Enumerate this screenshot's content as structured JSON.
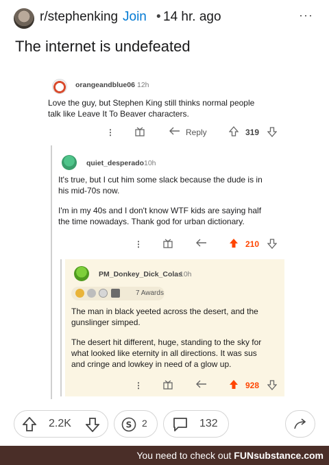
{
  "post": {
    "subreddit": "r/stephenking",
    "join_label": "Join",
    "separator": "•",
    "time": "14 hr. ago",
    "more": "···",
    "title": "The internet is undefeated"
  },
  "comments": [
    {
      "user": "orangeandblue06",
      "time": "12h",
      "lines": [
        "Love the guy, but Stephen King still thinks normal people",
        "talk like Leave It To Beaver characters."
      ],
      "reply_label": "Reply",
      "votes": "319"
    },
    {
      "user": "quiet_desperado",
      "time": "10h",
      "lines": [
        "It's true, but I cut him some slack because the dude is in",
        "his mid-70s now.",
        "",
        "I'm in my 40s and I don't know WTF kids are saying half",
        "the time nowadays.  Thank god for urban dictionary."
      ],
      "votes": "210"
    },
    {
      "user": "PM_Donkey_Dick_Colas",
      "time": "10h",
      "awards": "7 Awards",
      "lines": [
        "The man in black yeeted across the desert, and the",
        "gunslinger simped.",
        "",
        "The desert hit different, huge, standing to the sky for",
        "what looked like eternity in all directions. It was sus",
        "and cringe and lowkey in need of a glow up."
      ],
      "votes": "928"
    }
  ],
  "action_bar": {
    "score": "2.2K",
    "awards_count": "2",
    "comments_count": "132"
  },
  "footer": {
    "text": "You need to check out ",
    "brand": "FUNsubstance.com"
  },
  "colors": {
    "upvote_active": "#ff4500",
    "join": "#0079d3",
    "highlight_bg": "#fbf5e3",
    "footer_bg": "#4a2e28"
  }
}
